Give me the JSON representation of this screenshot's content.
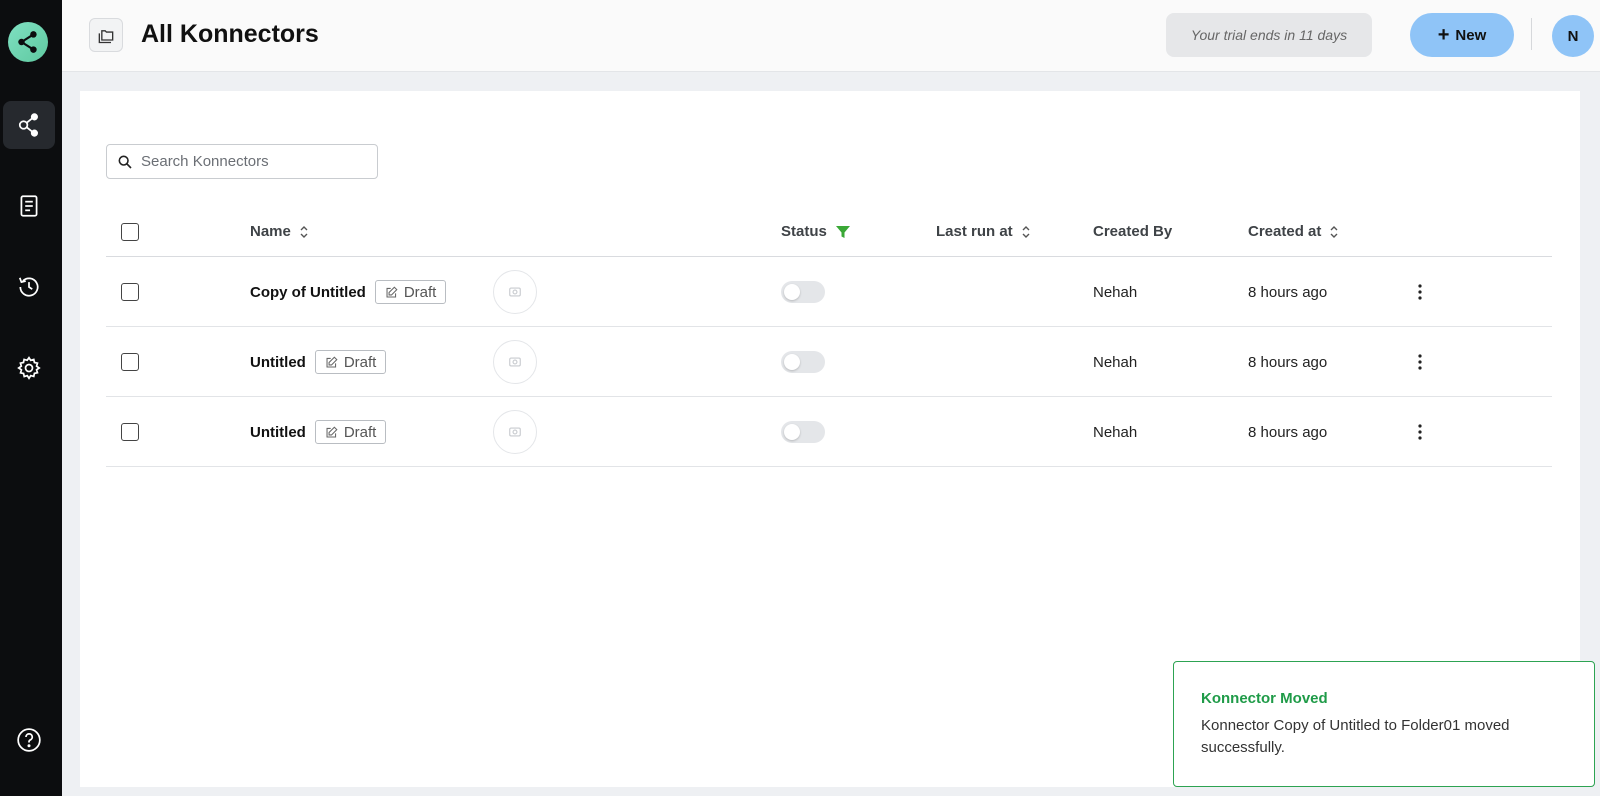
{
  "header": {
    "title": "All Konnectors",
    "trial_text": "Your trial ends in 11 days",
    "new_button_label": "New",
    "avatar_initial": "N"
  },
  "sidebar": {
    "items": [
      {
        "name": "konnectors",
        "icon": "share-nodes-icon",
        "active": true
      },
      {
        "name": "logs",
        "icon": "document-icon",
        "active": false
      },
      {
        "name": "history",
        "icon": "history-icon",
        "active": false
      },
      {
        "name": "settings",
        "icon": "gear-icon",
        "active": false
      }
    ],
    "help_icon": "help-icon"
  },
  "search": {
    "placeholder": "Search Konnectors",
    "value": ""
  },
  "table": {
    "columns": {
      "name": "Name",
      "status": "Status",
      "last_run_at": "Last run at",
      "created_by": "Created By",
      "created_at": "Created at"
    },
    "rows": [
      {
        "name": "Copy of Untitled",
        "badge": "Draft",
        "status_on": false,
        "last_run_at": "",
        "created_by": "Nehah",
        "created_at": "8 hours ago"
      },
      {
        "name": "Untitled",
        "badge": "Draft",
        "status_on": false,
        "last_run_at": "",
        "created_by": "Nehah",
        "created_at": "8 hours ago"
      },
      {
        "name": "Untitled",
        "badge": "Draft",
        "status_on": false,
        "last_run_at": "",
        "created_by": "Nehah",
        "created_at": "8 hours ago"
      }
    ]
  },
  "toast": {
    "title": "Konnector Moved",
    "message": "Konnector Copy of Untitled to Folder01 moved successfully."
  },
  "colors": {
    "sidebar_bg": "#0c0d0f",
    "accent_blue": "#8fc4f7",
    "success_green": "#1f9b48",
    "filter_green": "#3aa836"
  }
}
